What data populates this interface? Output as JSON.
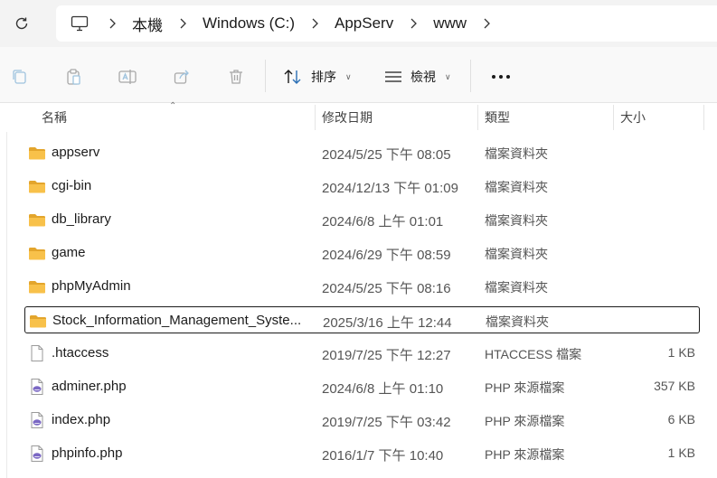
{
  "address": {
    "crumbs": [
      "本機",
      "Windows (C:)",
      "AppServ",
      "www"
    ]
  },
  "toolbar": {
    "sort_label": "排序",
    "view_label": "檢視"
  },
  "columns": {
    "name": "名稱",
    "modified": "修改日期",
    "type": "類型",
    "size": "大小"
  },
  "files": [
    {
      "name": "appserv",
      "modified": "2024/5/25 下午 08:05",
      "type": "檔案資料夾",
      "size": "",
      "icon": "folder-icon"
    },
    {
      "name": "cgi-bin",
      "modified": "2024/12/13 下午 01:09",
      "type": "檔案資料夾",
      "size": "",
      "icon": "folder-icon"
    },
    {
      "name": "db_library",
      "modified": "2024/6/8 上午 01:01",
      "type": "檔案資料夾",
      "size": "",
      "icon": "folder-icon"
    },
    {
      "name": "game",
      "modified": "2024/6/29 下午 08:59",
      "type": "檔案資料夾",
      "size": "",
      "icon": "folder-icon"
    },
    {
      "name": "phpMyAdmin",
      "modified": "2024/5/25 下午 08:16",
      "type": "檔案資料夾",
      "size": "",
      "icon": "folder-icon"
    },
    {
      "name": "Stock_Information_Management_Syste...",
      "modified": "2025/3/16 上午 12:44",
      "type": "檔案資料夾",
      "size": "",
      "icon": "folder-icon"
    },
    {
      "name": ".htaccess",
      "modified": "2019/7/25 下午 12:27",
      "type": "HTACCESS 檔案",
      "size": "1 KB",
      "icon": "blank-file-icon"
    },
    {
      "name": "adminer.php",
      "modified": "2024/6/8 上午 01:10",
      "type": "PHP 來源檔案",
      "size": "357 KB",
      "icon": "php-file-icon"
    },
    {
      "name": "index.php",
      "modified": "2019/7/25 下午 03:42",
      "type": "PHP 來源檔案",
      "size": "6 KB",
      "icon": "php-file-icon"
    },
    {
      "name": "phpinfo.php",
      "modified": "2016/1/7 下午 10:40",
      "type": "PHP 來源檔案",
      "size": "1 KB",
      "icon": "php-file-icon"
    }
  ],
  "selected_index": 5,
  "colors": {
    "folder": "#f8c14a",
    "folder_dark": "#e3a52c",
    "php": "#7b68c4",
    "selection_border": "#1b1b1b"
  }
}
